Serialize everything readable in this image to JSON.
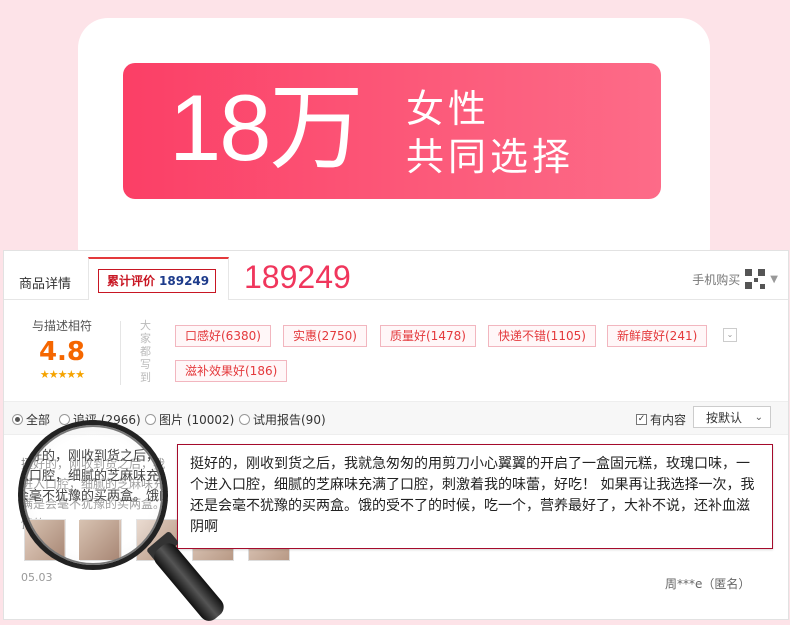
{
  "hero": {
    "number": "18万",
    "line1": "女性",
    "line2": "共同选择"
  },
  "tabs": {
    "detail": "商品详情",
    "reviews_label": "累计评价",
    "reviews_count": "189249",
    "big_count": "189249",
    "mobile_buy": "手机购买"
  },
  "rating": {
    "label": "与描述相符",
    "score": "4.8",
    "stars": "★★★★★"
  },
  "tags_header": "大家都写到",
  "tags": [
    "口感好(6380)",
    "实惠(2750)",
    "质量好(1478)",
    "快递不错(1105)",
    "新鲜度好(241)",
    "滋补效果好(186)"
  ],
  "filters": {
    "all": "全部",
    "append": "追评 (2966)",
    "images": "图片 (10002)",
    "trial": "试用报告(90)",
    "has_content": "有内容",
    "sort": "按默认",
    "has_content_checked": true
  },
  "review": {
    "text": "挺好的，刚收到货之后，我就急匆匆的用剪刀小心翼翼的开启了一盒固元糕，玫瑰口味，一个进入口腔，细腻的芝麻味充满了口腔，刺激着我的味蕾，好吃！ 如果再让我选择一次，我还是会毫不犹豫的买两盒。饿的受不了的时候，吃一个，营养最好了，大补不说，还补血滋阴啊",
    "lens_text": "挺好的，刚收到货之后，我进入口腔，细腻的芝麻味充满是会毫不犹豫的买两盒。饿的",
    "date": "05.03",
    "reviewer": "周***e（匿名）"
  },
  "colors": {
    "hero_start": "#fb3f66",
    "hero_end": "#fd6b88",
    "accent": "#f0365c",
    "tag_border": "#f2b6bf",
    "score": "#f56600",
    "page_bg": "#fde3e8"
  }
}
